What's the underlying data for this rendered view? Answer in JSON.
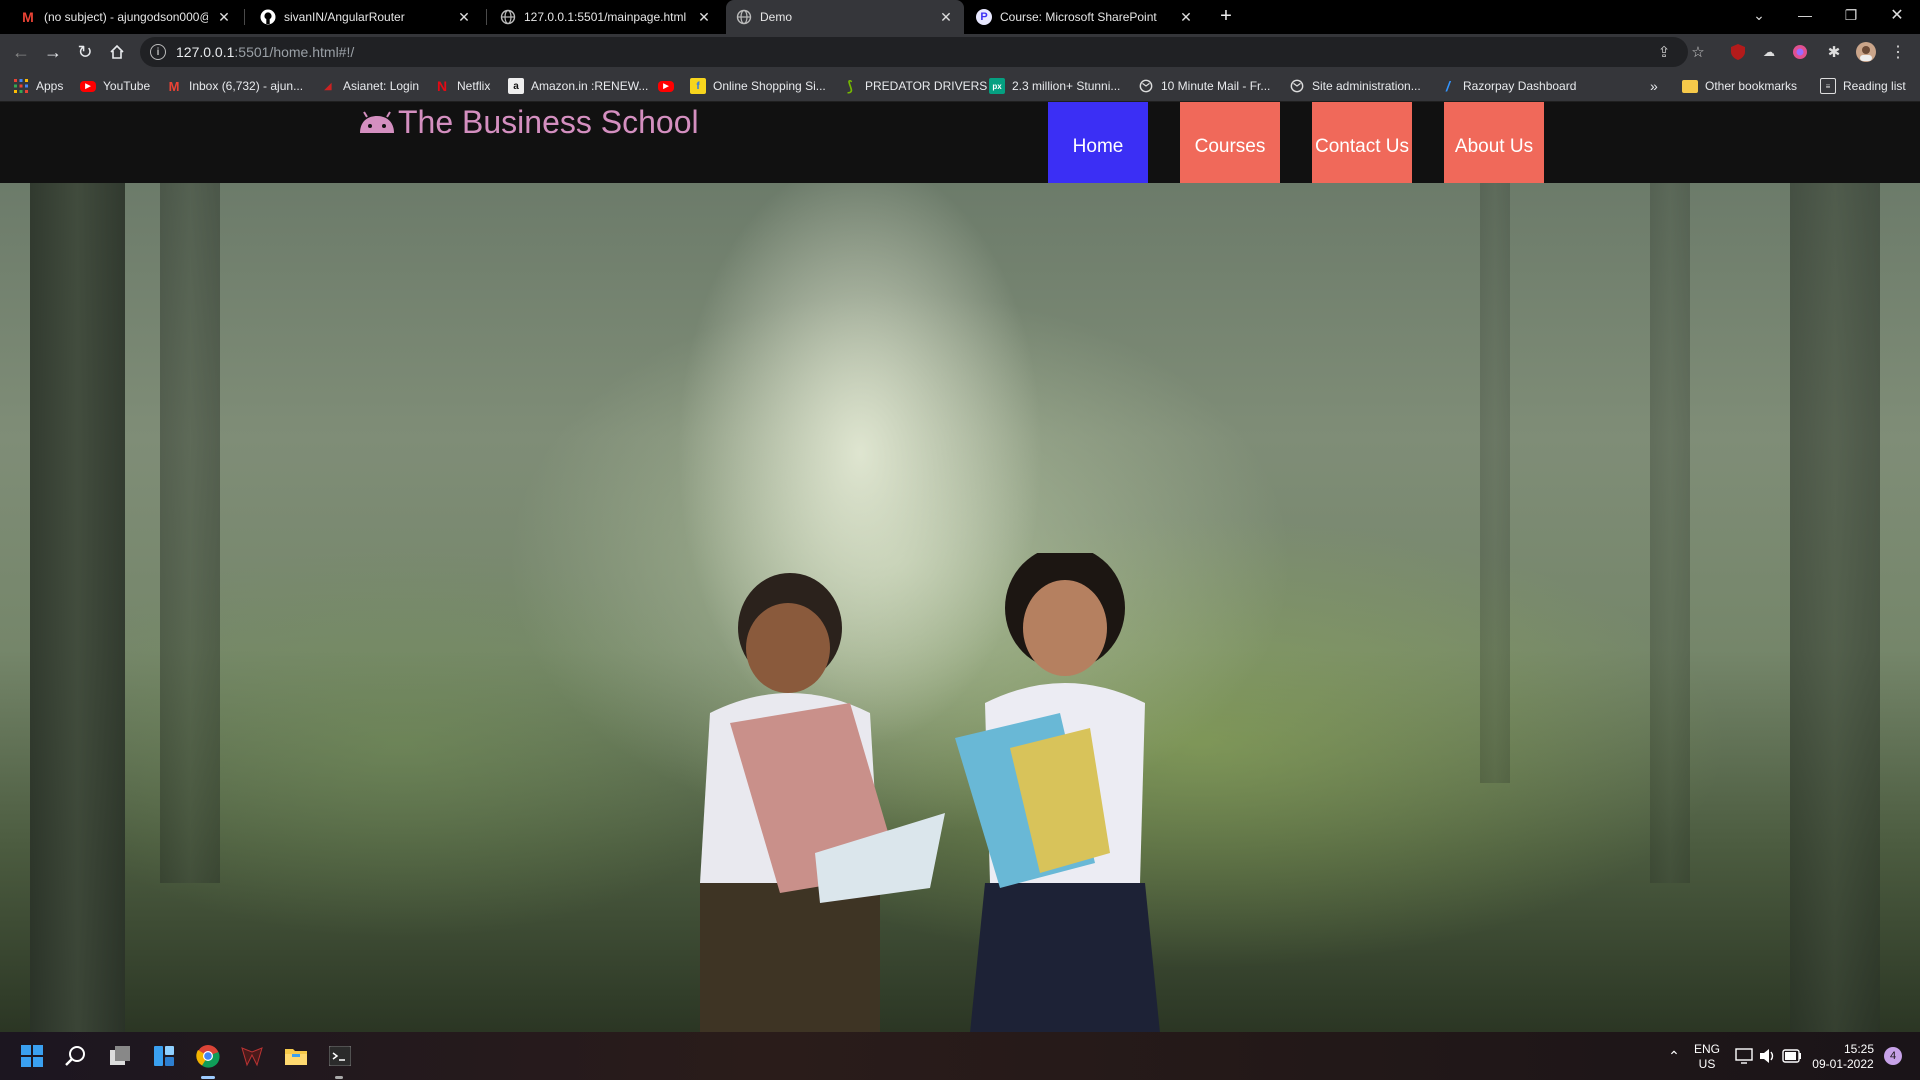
{
  "browser": {
    "tabs": [
      {
        "title": "(no subject) - ajungodson000@g",
        "icon": "gmail-icon"
      },
      {
        "title": "sivanIN/AngularRouter",
        "icon": "github-icon"
      },
      {
        "title": "127.0.0.1:5501/mainpage.html",
        "icon": "globe-icon"
      },
      {
        "title": "Demo",
        "icon": "globe-icon",
        "active": true
      },
      {
        "title": "Course: Microsoft SharePoint",
        "icon": "sharepoint-icon"
      }
    ],
    "address": {
      "host": "127.0.0.1",
      "rest": ":5501/home.html#!/"
    },
    "bookmarks": [
      {
        "label": "Apps",
        "icon": "apps-grid-icon"
      },
      {
        "label": "YouTube",
        "icon": "youtube-icon"
      },
      {
        "label": "Inbox (6,732) - ajun...",
        "icon": "gmail-icon"
      },
      {
        "label": "Asianet: Login",
        "icon": "asianet-icon"
      },
      {
        "label": "Netflix",
        "icon": "netflix-icon"
      },
      {
        "label": "Amazon.in :RENEW...",
        "icon": "amazon-icon"
      },
      {
        "label": "",
        "icon": "youtube-icon"
      },
      {
        "label": "Online Shopping Si...",
        "icon": "flipkart-icon"
      },
      {
        "label": "PREDATOR DRIVERS",
        "icon": "nvidia-icon"
      },
      {
        "label": "2.3 million+ Stunni...",
        "icon": "pexels-icon"
      },
      {
        "label": "10 Minute Mail - Fr...",
        "icon": "globe-icon"
      },
      {
        "label": "Site administration...",
        "icon": "globe-icon"
      },
      {
        "label": "Razorpay Dashboard",
        "icon": "razorpay-icon"
      }
    ],
    "other_bookmarks": "Other bookmarks",
    "reading_list": "Reading list",
    "overflow": "»"
  },
  "site": {
    "brand": "The Business School",
    "nav": [
      {
        "label": "Home",
        "active": true
      },
      {
        "label": "Courses"
      },
      {
        "label": "Contact Us"
      },
      {
        "label": "About Us"
      }
    ],
    "colors": {
      "nav_active": "#3b2ff5",
      "nav": "#f0695a",
      "brand": "#d48fc0"
    }
  },
  "taskbar": {
    "lang": "ENG",
    "region": "US",
    "time": "15:25",
    "date": "09-01-2022",
    "notifications": "4"
  }
}
